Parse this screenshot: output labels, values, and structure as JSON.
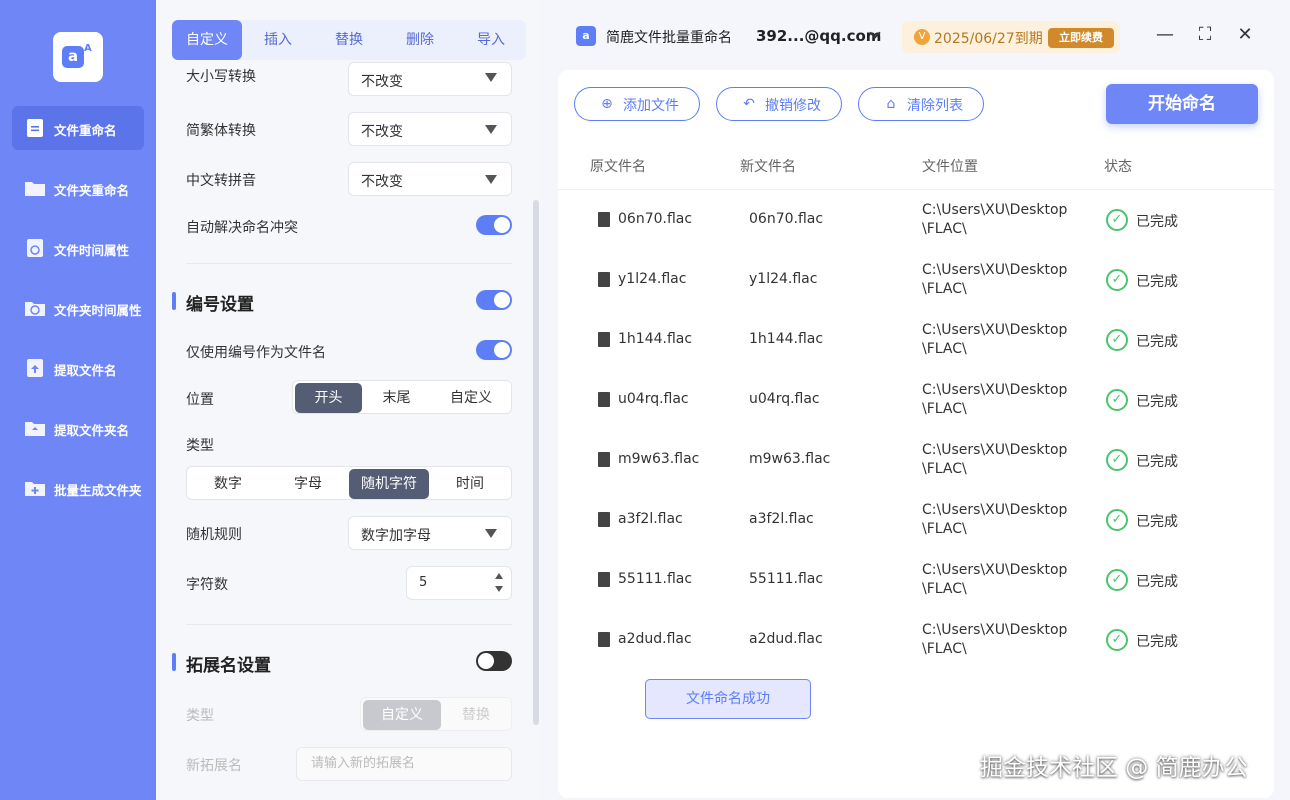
{
  "logo": {
    "letter": "a",
    "super": "A"
  },
  "sidebar": {
    "items": [
      {
        "label": "文件重命名"
      },
      {
        "label": "文件夹重命名"
      },
      {
        "label": "文件时间属性"
      },
      {
        "label": "文件夹时间属性"
      },
      {
        "label": "提取文件名"
      },
      {
        "label": "提取文件夹名"
      },
      {
        "label": "批量生成文件夹"
      }
    ],
    "active": "文件重命名"
  },
  "tabs": [
    {
      "label": "自定义"
    },
    {
      "label": "插入"
    },
    {
      "label": "替换"
    },
    {
      "label": "删除"
    },
    {
      "label": "导入"
    }
  ],
  "settings": {
    "case_label": "大小写转换",
    "case_value": "不改变",
    "trad_label": "简繁体转换",
    "trad_value": "不改变",
    "pinyin_label": "中文转拼音",
    "pinyin_value": "不改变",
    "conflict_label": "自动解决命名冲突",
    "conflict_on": true
  },
  "numbering": {
    "title": "编号设置",
    "enabled": true,
    "only_label": "仅使用编号作为文件名",
    "only_on": true,
    "position_label": "位置",
    "position_options": [
      "开头",
      "末尾",
      "自定义"
    ],
    "position_selected": "开头",
    "type_label": "类型",
    "type_options": [
      "数字",
      "字母",
      "随机字符",
      "时间"
    ],
    "type_selected": "随机字符",
    "rule_label": "随机规则",
    "rule_value": "数字加字母",
    "chars_label": "字符数",
    "chars_value": "5"
  },
  "extension": {
    "title": "拓展名设置",
    "enabled": false,
    "type_label": "类型",
    "type_options": [
      "自定义",
      "替换"
    ],
    "type_selected": "自定义",
    "new_label": "新拓展名",
    "new_placeholder": "请输入新的拓展名"
  },
  "titlebar": {
    "app_icon": "a",
    "app_title": "简鹿文件批量重命名",
    "account": "392...@qq.com",
    "vip_icon": "V",
    "vip_expiry": "2025/06/27到期",
    "renew_label": "立即续费",
    "minimize": "—",
    "maximize": "⛶",
    "close": "✕"
  },
  "toolbar": {
    "add_label": "添加文件",
    "undo_label": "撤销修改",
    "clear_label": "清除列表",
    "start_label": "开始命名"
  },
  "table": {
    "headers": {
      "orig": "原文件名",
      "new": "新文件名",
      "loc": "文件位置",
      "status": "状态"
    },
    "rows": [
      {
        "orig": "06n70.flac",
        "new": "06n70.flac",
        "loc1": "C:\\Users\\XU\\Desktop",
        "loc2": "\\FLAC\\",
        "status": "已完成"
      },
      {
        "orig": "y1l24.flac",
        "new": "y1l24.flac",
        "loc1": "C:\\Users\\XU\\Desktop",
        "loc2": "\\FLAC\\",
        "status": "已完成"
      },
      {
        "orig": "1h144.flac",
        "new": "1h144.flac",
        "loc1": "C:\\Users\\XU\\Desktop",
        "loc2": "\\FLAC\\",
        "status": "已完成"
      },
      {
        "orig": "u04rq.flac",
        "new": "u04rq.flac",
        "loc1": "C:\\Users\\XU\\Desktop",
        "loc2": "\\FLAC\\",
        "status": "已完成"
      },
      {
        "orig": "m9w63.flac",
        "new": "m9w63.flac",
        "loc1": "C:\\Users\\XU\\Desktop",
        "loc2": "\\FLAC\\",
        "status": "已完成"
      },
      {
        "orig": "a3f2l.flac",
        "new": "a3f2l.flac",
        "loc1": "C:\\Users\\XU\\Desktop",
        "loc2": "\\FLAC\\",
        "status": "已完成"
      },
      {
        "orig": "55111.flac",
        "new": "55111.flac",
        "loc1": "C:\\Users\\XU\\Desktop",
        "loc2": "\\FLAC\\",
        "status": "已完成"
      },
      {
        "orig": "a2dud.flac",
        "new": "a2dud.flac",
        "loc1": "C:\\Users\\XU\\Desktop",
        "loc2": "\\FLAC\\",
        "status": "已完成"
      }
    ]
  },
  "toast": "文件命名成功",
  "watermark": "掘金技术社区 @ 简鹿办公",
  "colors": {
    "accent": "#6f86f7",
    "success": "#4cc46b",
    "vip": "#d08a2b"
  }
}
